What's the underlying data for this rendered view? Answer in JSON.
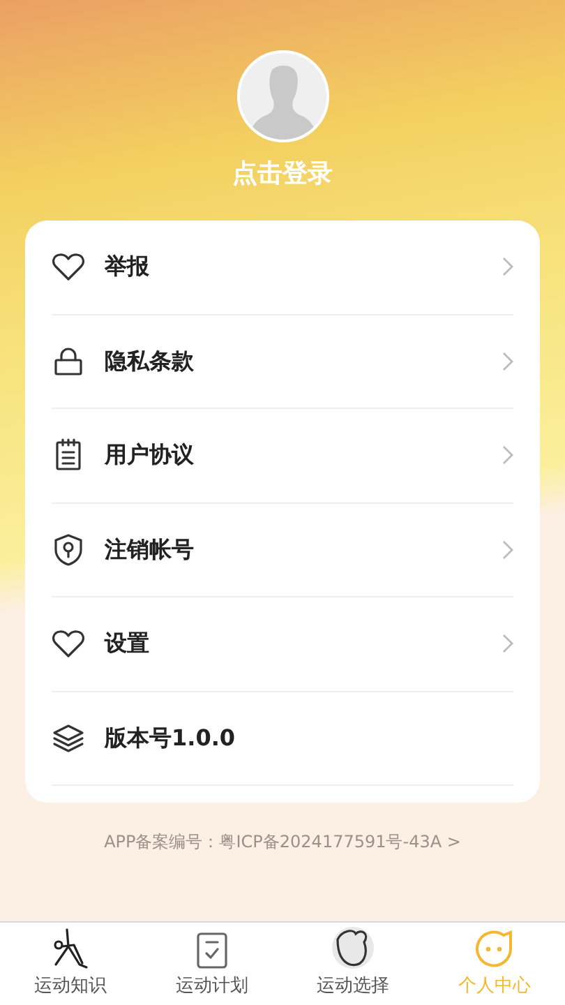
{
  "profile": {
    "login_label": "点击登录"
  },
  "menu": [
    {
      "label": "举报",
      "kind": "link"
    },
    {
      "label": "隐私条款",
      "kind": "link"
    },
    {
      "label": "用户协议",
      "kind": "link"
    },
    {
      "label": "注销帐号",
      "kind": "link"
    },
    {
      "label": "设置",
      "kind": "link"
    },
    {
      "label": "版本号1.0.0",
      "kind": "info"
    }
  ],
  "record_number": "APP备案编号：粤ICP备2024177591号-43A >",
  "tab_bar": [
    {
      "label": "运动知识",
      "selected": false
    },
    {
      "label": "运动计划",
      "selected": false
    },
    {
      "label": "运动选择",
      "selected": false
    },
    {
      "label": "个人中心",
      "selected": true
    }
  ]
}
